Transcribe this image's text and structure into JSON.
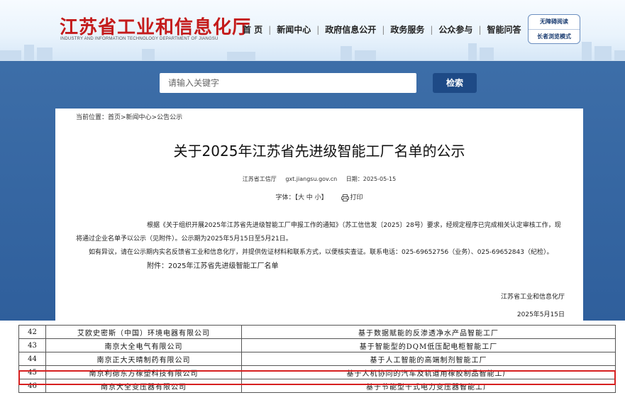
{
  "header": {
    "logo_cn": "江苏省工业和信息化厅",
    "logo_en": "INDUSTRY AND INFORMATION TECHNOLOGY DEPARTMENT OF JIANGSU",
    "nav": [
      "首 页",
      "新闻中心",
      "政府信息公开",
      "政务服务",
      "公众参与",
      "智能问答"
    ],
    "accessibility": [
      "无障碍阅读",
      "长者浏览模式"
    ]
  },
  "search": {
    "placeholder": "请输入关键字",
    "button": "检索"
  },
  "breadcrumb": "当前位置：首页>新闻中心>公告公示",
  "article": {
    "title": "关于2025年江苏省先进级智能工厂名单的公示",
    "source": "江苏省工信厅",
    "site": "gxt.jiangsu.gov.cn",
    "date_label": "日期：2025-05-15",
    "font_label": "字体：【大 中 小】",
    "print_label": "打印",
    "para1": "根据《关于组织开展2025年江苏省先进级智能工厂申报工作的通知》（苏工信信发〔2025〕28号）要求，经规定程序已完成相关认定审核工作，现将通过企业名单予以公示（见附件）。公示期为2025年5月15日至5月21日。",
    "para2": "如有异议，请在公示期内实名反馈省工业和信息化厅，并提供佐证材料和联系方式，以便核实查证。联系电话：025-69652756（业务）、025-69652843（纪检）。",
    "attachment": "附件：2025年江苏省先进级智能工厂名单",
    "signature": "江苏省工业和信息化厅",
    "sign_date": "2025年5月15日"
  },
  "table": {
    "rows": [
      {
        "no": "42",
        "company": "艾欧史密斯（中国）环境电器有限公司",
        "project": "基于数据赋能的反渗透净水产品智能工厂"
      },
      {
        "no": "43",
        "company": "南京大全电气有限公司",
        "project": "基于智能型的DQM低压配电柜智能工厂"
      },
      {
        "no": "44",
        "company": "南京正大天晴制药有限公司",
        "project": "基于人工智能的高端制剂智能工厂"
      },
      {
        "no": "45",
        "company": "南京利德东方橡塑科技有限公司",
        "project": "基于人机协同的汽车及轨道用橡胶制品智能工厂"
      },
      {
        "no": "46",
        "company": "南京大全变压器有限公司",
        "project": "基于节能型干式电力变压器智能工厂"
      }
    ],
    "highlight_color": "#d62020"
  }
}
